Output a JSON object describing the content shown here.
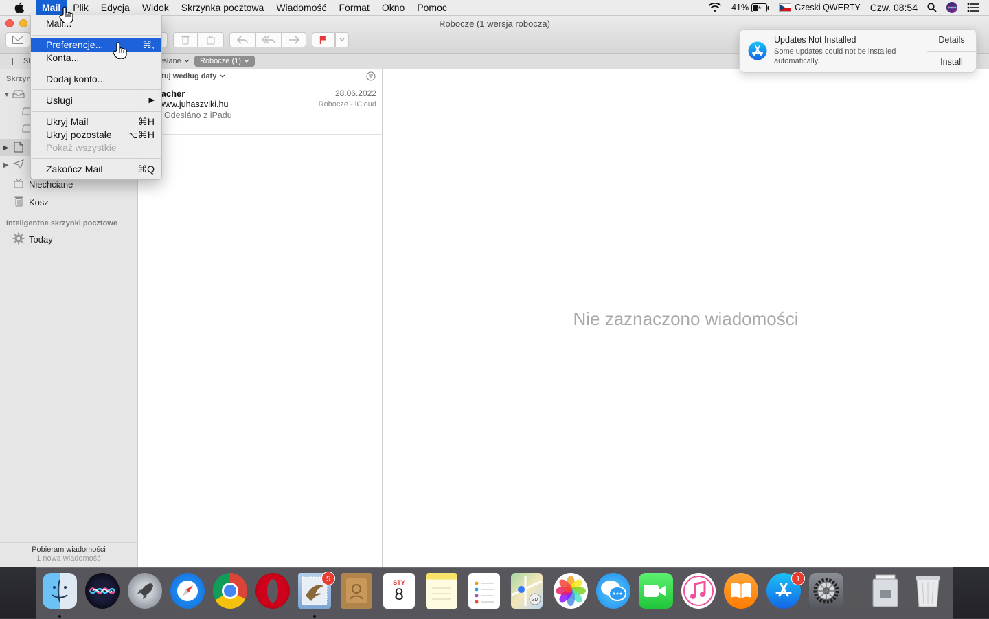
{
  "menubar": {
    "app_name": "Mail",
    "items": [
      "Plik",
      "Edycja",
      "Widok",
      "Skrzynka pocztowa",
      "Wiadomość",
      "Format",
      "Okno",
      "Pomoc"
    ],
    "battery": "41%",
    "input_source": "Czeski QWERTY",
    "clock": "Czw. 08:54"
  },
  "window": {
    "title": "Robocze (1 wersja robocza)"
  },
  "favorites": {
    "hidden_label": "Sk",
    "sent": "ysłane",
    "drafts": "Robocze (1)"
  },
  "sidebar": {
    "section_mailboxes": "Skrzyn",
    "junk": "Niechciane",
    "trash": "Kosz",
    "smart_section": "Inteligentne skrzynki pocztowe",
    "today": "Today",
    "status_line1": "Pobieram wiadomości",
    "status_line2": "1 nowa wiadomość"
  },
  "message_list": {
    "sort_label": "rtuj według daty",
    "messages": [
      {
        "sender": "lacher",
        "date": "28.06.2022",
        "subject": "www.juhaszviki.hu",
        "mailbox": "Robocze - iCloud",
        "preview": "Odesláno z iPadu"
      }
    ]
  },
  "viewer": {
    "empty_text": "Nie zaznaczono wiadomości"
  },
  "mail_menu": {
    "items": [
      {
        "label": "Mail...",
        "shortcut": ""
      },
      {
        "label": "Preferencje...",
        "shortcut": "⌘,"
      },
      {
        "label": "Konta...",
        "shortcut": ""
      },
      {
        "label": "Dodaj konto...",
        "shortcut": ""
      },
      {
        "label": "Usługi",
        "shortcut": "▶"
      },
      {
        "label": "Ukryj Mail",
        "shortcut": "⌘H"
      },
      {
        "label": "Ukryj pozostałe",
        "shortcut": "⌥⌘H"
      },
      {
        "label": "Pokaż wszystkie",
        "shortcut": ""
      },
      {
        "label": "Zakończ Mail",
        "shortcut": "⌘Q"
      }
    ]
  },
  "notification": {
    "title": "Updates Not Installed",
    "body": "Some updates could not be installed automatically.",
    "details_button": "Details",
    "install_button": "Install"
  },
  "dock": {
    "calendar_month": "STY",
    "calendar_day": "8",
    "mail_badge": "5",
    "appstore_badge": "1"
  },
  "colors": {
    "menu_highlight": "#1d62d8",
    "close": "#fc5f57",
    "minimize": "#fdbc2e",
    "badge": "#ea3b30"
  }
}
